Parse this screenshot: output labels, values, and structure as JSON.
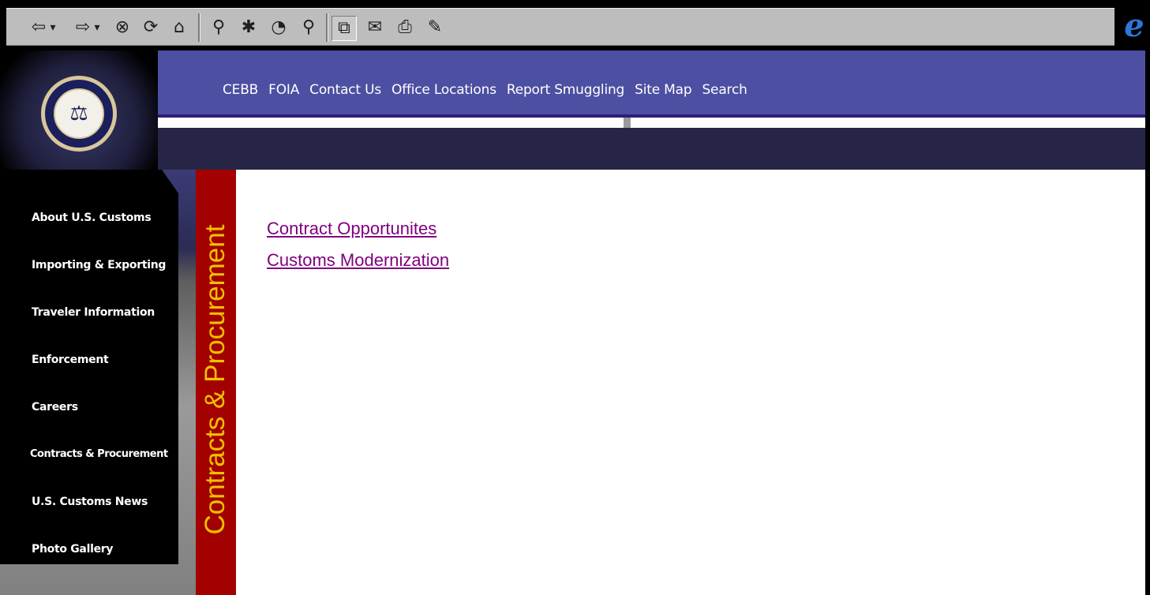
{
  "toolbar": {
    "buttons": [
      {
        "icon": "back-arrow-icon",
        "glyph": "⇦"
      },
      {
        "icon": "dropdown-icon",
        "glyph": "▾"
      },
      {
        "icon": "forward-arrow-icon",
        "glyph": "⇨"
      },
      {
        "icon": "dropdown-icon",
        "glyph": "▾"
      },
      {
        "icon": "stop-icon",
        "glyph": "⊗"
      },
      {
        "icon": "refresh-icon",
        "glyph": "⟳"
      },
      {
        "icon": "home-icon",
        "glyph": "⌂"
      },
      {
        "icon": "search-icon",
        "glyph": "⚲"
      },
      {
        "icon": "favorites-icon",
        "glyph": "✱"
      },
      {
        "icon": "history-icon",
        "glyph": "◔"
      },
      {
        "icon": "channels-icon",
        "glyph": "⚲"
      },
      {
        "icon": "fullscreen-icon",
        "glyph": "⧉"
      },
      {
        "icon": "mail-icon",
        "glyph": "✉"
      },
      {
        "icon": "print-icon",
        "glyph": "⎙"
      },
      {
        "icon": "edit-icon",
        "glyph": "✎"
      }
    ],
    "ie_logo": "e"
  },
  "header": {
    "nav": [
      "CEBB",
      "FOIA",
      "Contact Us",
      "Office Locations",
      "Report Smuggling",
      "Site Map",
      "Search"
    ],
    "seal_glyph": "⚖"
  },
  "sidebar": {
    "items": [
      "About  U.S. Customs",
      "Importing & Exporting",
      "Traveler Information",
      "Enforcement",
      "Careers",
      "Contracts & Procurement",
      "U.S. Customs News",
      "Photo Gallery"
    ]
  },
  "section": {
    "title": "Contracts & Procurement"
  },
  "content": {
    "links": [
      "Contract Opportunites",
      "Customs Modernization"
    ]
  },
  "colors": {
    "nav_band": "#4d4fa2",
    "navy_band": "#262546",
    "banner_red": "#a30000",
    "banner_text": "#f0c000",
    "visited_link": "#800080"
  }
}
